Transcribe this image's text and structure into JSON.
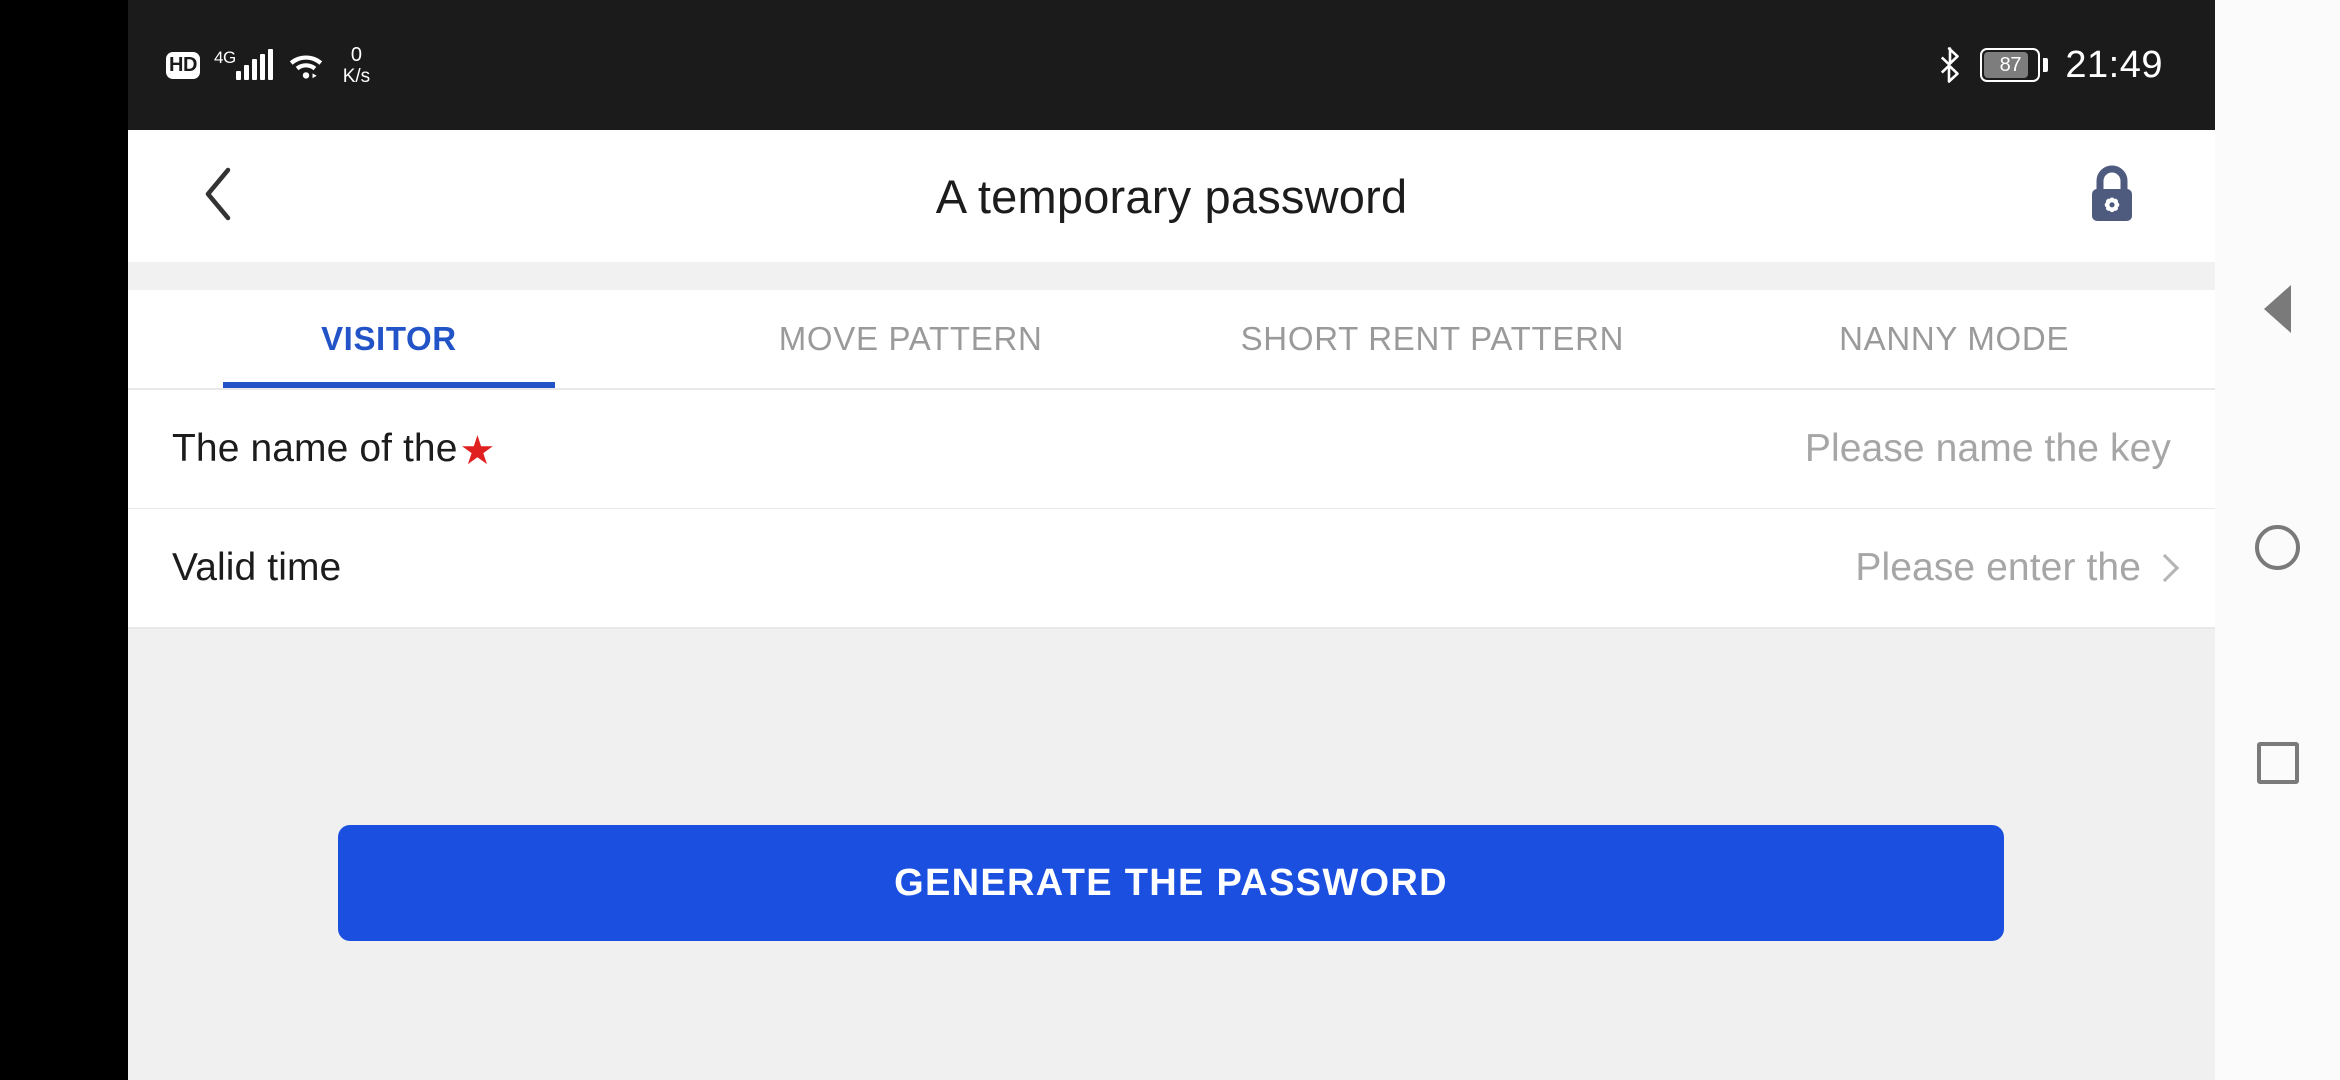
{
  "status_bar": {
    "hd_badge": "HD",
    "network_type": "4G",
    "signal_icon": "signal-bars-icon",
    "wifi_icon": "wifi-icon",
    "data_rate_value": "0",
    "data_rate_unit": "K/s",
    "bluetooth_icon": "bluetooth-icon",
    "battery_level": "87",
    "clock": "21:49"
  },
  "header": {
    "back_icon": "chevron-left-icon",
    "title": "A temporary password",
    "lock_icon": "lock-settings-icon",
    "lock_color": "#4e5a7e"
  },
  "tabs": {
    "active_index": 0,
    "active_color": "#2254c8",
    "inactive_color": "#9a9a9a",
    "items": [
      {
        "label": "VISITOR"
      },
      {
        "label": "MOVE PATTERN"
      },
      {
        "label": "SHORT RENT PATTERN"
      },
      {
        "label": "NANNY MODE"
      }
    ]
  },
  "form": {
    "rows": [
      {
        "label": "The name of the",
        "required_marker": "★",
        "required_color": "#e02020",
        "placeholder": "Please name the key",
        "has_chevron": false
      },
      {
        "label": "Valid time",
        "placeholder": "Please enter the",
        "chevron_icon": "chevron-right-icon",
        "has_chevron": true
      }
    ]
  },
  "main": {
    "generate_button_label": "GENERATE THE PASSWORD",
    "generate_button_color": "#1b4fe0",
    "background_color": "#f0f0f0"
  },
  "navbar": {
    "back_icon": "nav-back-triangle-icon",
    "home_icon": "nav-home-circle-icon",
    "recent_icon": "nav-recents-square-icon"
  }
}
